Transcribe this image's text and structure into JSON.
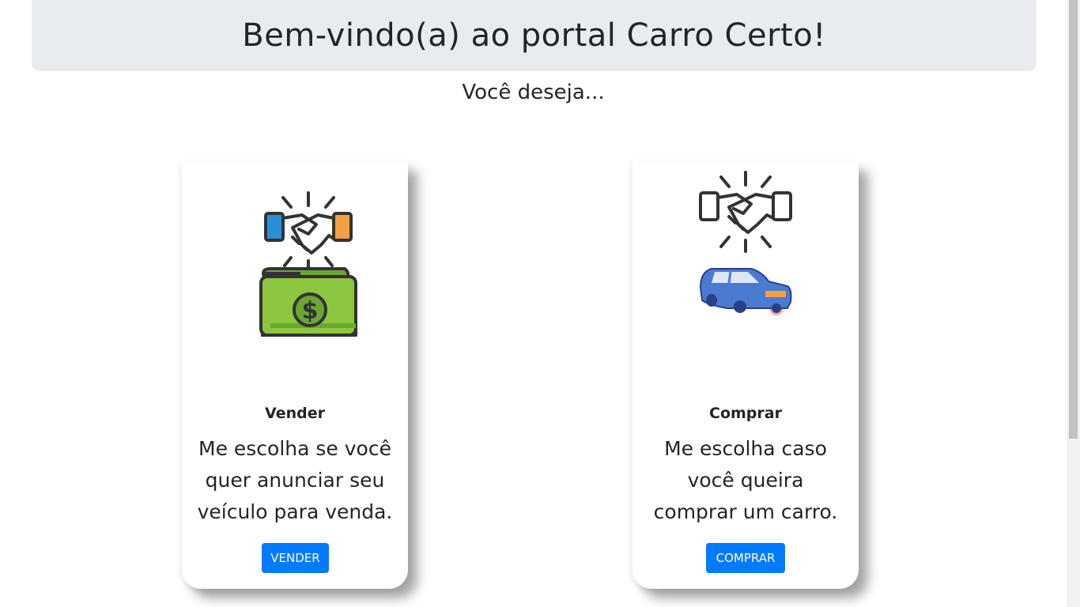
{
  "header": {
    "title": "Bem-vindo(a) ao portal Carro Certo!"
  },
  "subtitle": "Você deseja...",
  "cards": [
    {
      "title": "Vender",
      "description": "Me escolha se você quer anunciar seu veículo para venda.",
      "button_label": "VENDER",
      "icons": [
        "handshake-icon",
        "money-wallet-icon"
      ]
    },
    {
      "title": "Comprar",
      "description": "Me escolha caso você queira comprar um carro.",
      "button_label": "COMPRAR",
      "icons": [
        "handshake-icon",
        "car-icon"
      ]
    }
  ],
  "colors": {
    "primary_button": "#007bff",
    "jumbotron_bg": "#e9ecef",
    "text": "#212529",
    "money_green": "#8dc63f",
    "car_blue": "#4a7bd0"
  }
}
